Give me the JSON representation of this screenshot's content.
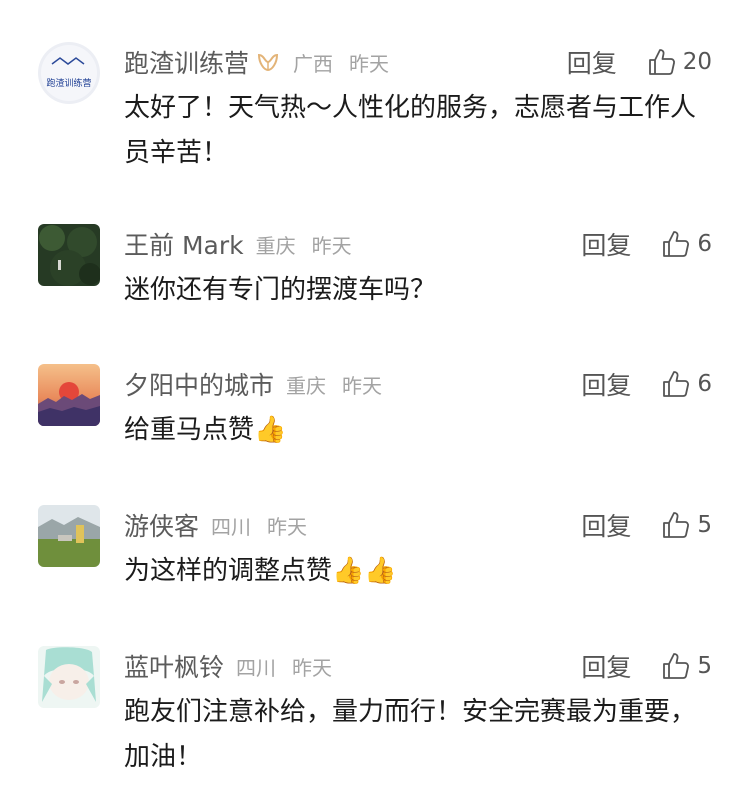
{
  "ui": {
    "reply_label": "回复"
  },
  "comments": [
    {
      "username": "跑渣训练营",
      "avatar_text": "跑渣训练营",
      "badge_icon": "medal-ribbon-icon",
      "region": "广西",
      "time": "昨天",
      "likes": "20",
      "text": "太好了！天气热～人性化的服务，志愿者与工作人员辛苦！"
    },
    {
      "username": "王前 Mark",
      "region": "重庆",
      "time": "昨天",
      "likes": "6",
      "text": "迷你还有专门的摆渡车吗？"
    },
    {
      "username": "夕阳中的城市",
      "region": "重庆",
      "time": "昨天",
      "likes": "6",
      "text": "给重马点赞",
      "emoji": "👍"
    },
    {
      "username": "游侠客",
      "region": "四川",
      "time": "昨天",
      "likes": "5",
      "text": "为这样的调整点赞",
      "emoji": "👍👍"
    },
    {
      "username": "蓝叶枫铃",
      "region": "四川",
      "time": "昨天",
      "likes": "5",
      "text": "跑友们注意补给，量力而行！安全完赛最为重要，加油！"
    }
  ]
}
